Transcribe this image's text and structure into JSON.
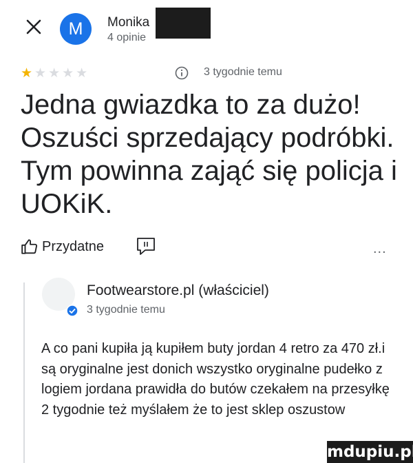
{
  "reviewer": {
    "initial": "M",
    "name": "Monika",
    "review_count": "4 opinie"
  },
  "rating": {
    "filled": "★",
    "empty": "★★★★",
    "value": 1,
    "max": 5
  },
  "review": {
    "time": "3 tygodnie temu",
    "text": "Jedna gwiazdka to za dużo! Oszuści sprzedający podróbki. Tym powinna zająć się policja i UOKiK."
  },
  "actions": {
    "helpful_label": "Przydatne",
    "more": "..."
  },
  "owner_reply": {
    "name": "Footwearstore.pl (właściciel)",
    "time": "3 tygodnie temu",
    "text": "A co pani kupiła ją kupiłem buty jordan 4 retro za 470 zł.i są oryginalne jest donich wszystko oryginalne pudełko z logiem jordana prawidła do butów czekałem na przesyłkę 2 tygodnie też myślałem że to jest sklep oszustow"
  },
  "watermark": "mdupiu.pl",
  "colors": {
    "avatar": "#1a73e8",
    "star": "#f4b400",
    "secondary_text": "#5f6368",
    "verified_badge": "#1a73e8"
  },
  "icons": [
    "close-icon",
    "info-icon",
    "thumbs-up-icon",
    "share-icon",
    "more-icon",
    "verified-icon"
  ]
}
